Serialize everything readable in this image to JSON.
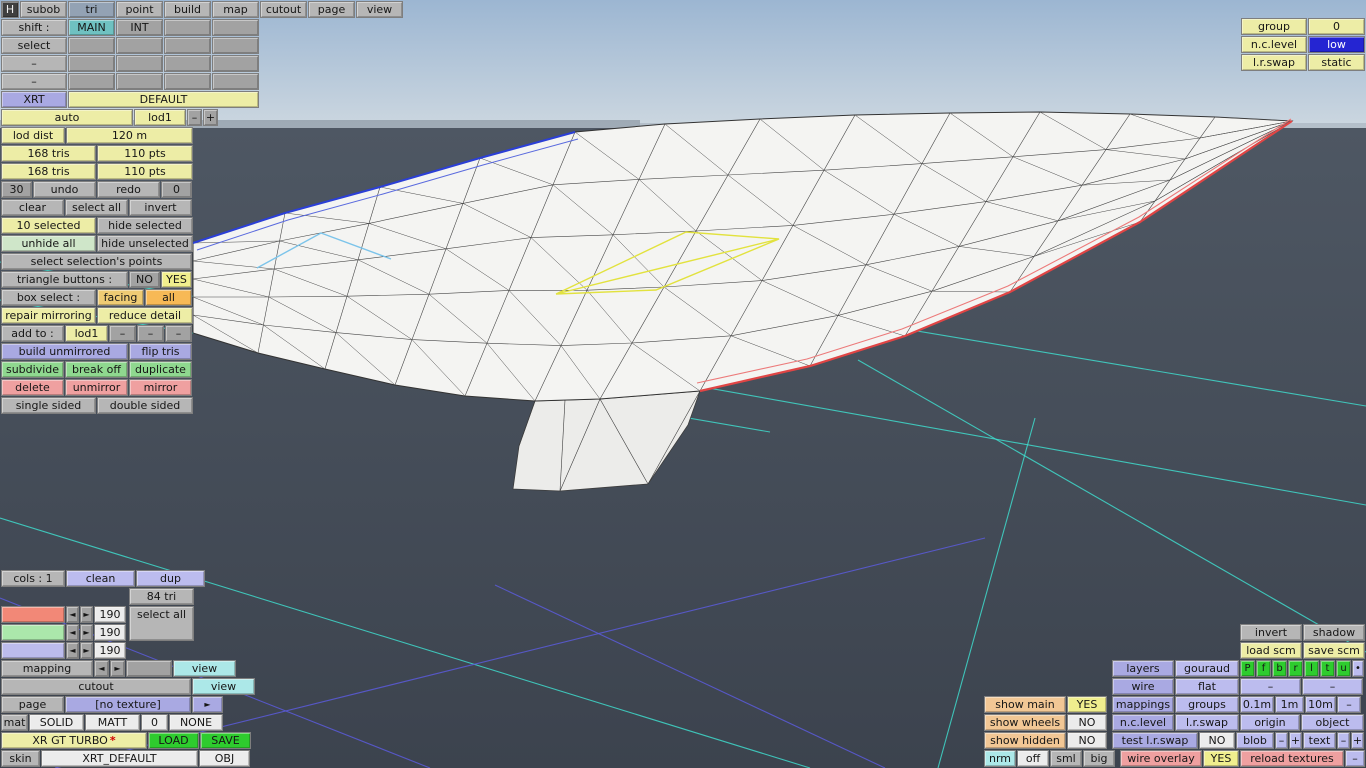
{
  "colors": {
    "accent_yellow": "#ededa6",
    "teal": "#6fc1c1",
    "peach": "#f2c795",
    "green_bright": "#2ecc2e",
    "green_light": "#8fd88f",
    "pink": "#efa0a0",
    "lavender": "#a9a9e2",
    "cyan": "#ace8e8",
    "ncl_low_bg": "#2525d2",
    "highlight_red": "#e04545",
    "highlight_yellow": "#e2e23e",
    "highlight_blue": "#2b3fd6",
    "grid_cyan": "#3fe3d3",
    "grid_purple": "#5b5bdb"
  },
  "topbar": [
    "H",
    "subob",
    "tri",
    "point",
    "build",
    "map",
    "cutout",
    "page",
    "view"
  ],
  "mode_rows": {
    "shift_label": "shift :",
    "main": "MAIN",
    "int": "INT",
    "select": "select",
    "minus": "–",
    "plus": "+",
    "xrt": "XRT",
    "default": "DEFAULT",
    "auto": "auto",
    "lod1": "lod1"
  },
  "left": {
    "rows": [
      [
        "lod dist",
        "120 m"
      ],
      [
        "168 tris",
        "110 pts"
      ],
      [
        "168 tris",
        "110 pts"
      ],
      [
        "30",
        "undo",
        "redo",
        "0"
      ],
      [
        "clear",
        "select all",
        "invert"
      ],
      [
        "10 selected",
        "hide selected"
      ],
      [
        "unhide all",
        "hide unselected"
      ],
      [
        "select selection's points"
      ],
      [
        "triangle buttons :",
        "NO",
        "YES"
      ],
      [
        "box select :",
        "facing",
        "all"
      ],
      [
        "repair mirroring",
        "reduce detail"
      ],
      [
        "add to :",
        "lod1",
        "–",
        "–",
        "–"
      ],
      [
        "build unmirrored",
        "flip tris"
      ],
      [
        "subdivide",
        "break off",
        "duplicate"
      ],
      [
        "delete",
        "unmirror",
        "mirror"
      ],
      [
        "single sided",
        "double sided"
      ]
    ]
  },
  "topright": {
    "rows": [
      [
        "group",
        "0"
      ],
      [
        "n.c.level",
        "low"
      ],
      [
        "l.r.swap",
        "static"
      ]
    ]
  },
  "matpanel": {
    "cols": [
      "cols : 1",
      "clean",
      "dup"
    ],
    "tri_count": "84 tri",
    "select_all": "select all",
    "values": [
      "190",
      "190",
      "190"
    ],
    "swatch_styles": [
      "background:#f28877",
      "background:#abe7ab",
      "background:#bcbcec"
    ],
    "left_arrow": "◄",
    "right_arrow": "►",
    "mapping": "mapping",
    "cutout": "cutout",
    "view": "view",
    "page": "page",
    "texture": "[no texture]",
    "next": "►",
    "mat": "mat",
    "solid": "SOLID",
    "matt": "MATT",
    "zero": "0",
    "none": "NONE",
    "model": "XR GT TURBO",
    "star": "*",
    "load": "LOAD",
    "save": "SAVE",
    "skin": "skin",
    "skin_name": "XRT_DEFAULT",
    "obj": "OBJ"
  },
  "view_panel": {
    "invert": "invert",
    "shadow": "shadow",
    "load_scm": "load scm",
    "save_scm": "save scm",
    "layers": "layers",
    "gouraud": "gouraud",
    "layer_toggles": [
      "P",
      "f",
      "b",
      "r",
      "l",
      "t",
      "u"
    ],
    "dot": "•",
    "wire": "wire",
    "flat": "flat",
    "dash": "–",
    "plus": "+",
    "show_main": "show main",
    "yes": "YES",
    "no": "NO",
    "mappings": "mappings",
    "groups": "groups",
    "scale_01": "0.1m",
    "scale_1": "1m",
    "scale_10": "10m",
    "show_wheels": "show wheels",
    "ncl": "n.c.level",
    "lrswap": "l.r.swap",
    "origin": "origin",
    "object": "object",
    "show_hidden": "show hidden",
    "test_lrswap": "test l.r.swap",
    "blob": "blob",
    "text": "text",
    "nrm": "nrm",
    "off": "off",
    "sml": "sml",
    "big": "big",
    "wire_overlay": "wire overlay",
    "reload_textures": "reload textures"
  }
}
